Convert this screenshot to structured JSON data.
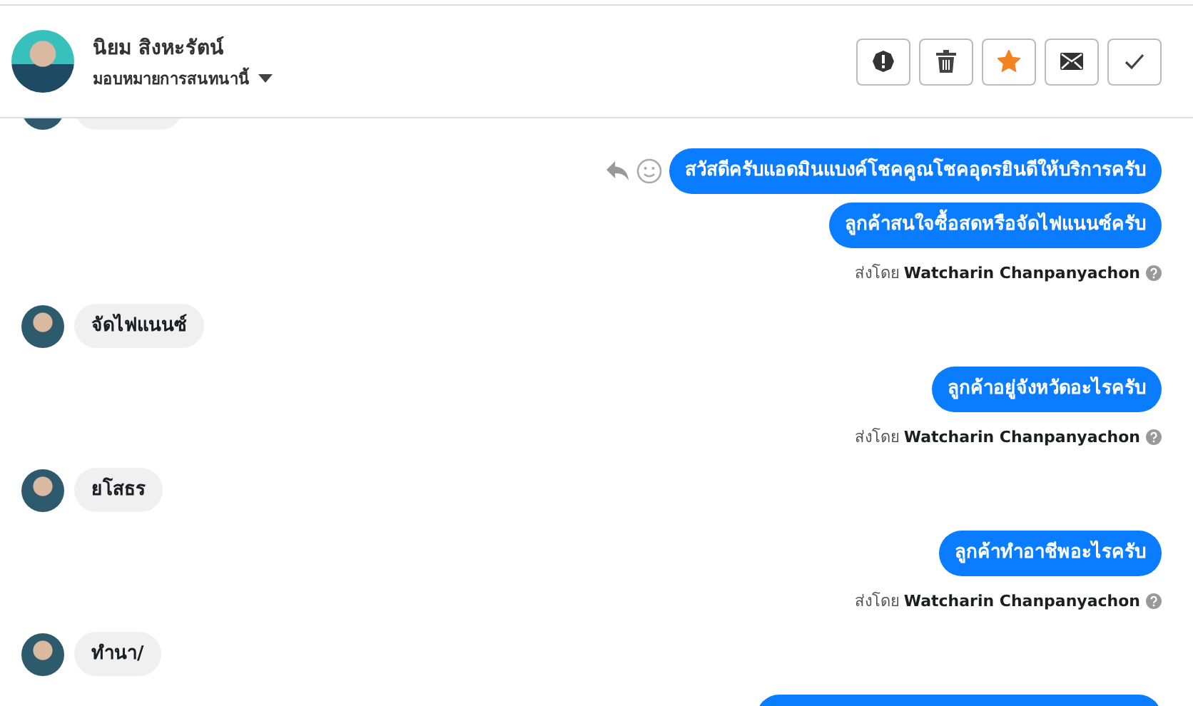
{
  "contact": {
    "name": "นิยม สิงหะรัตน์",
    "subtitle": "มอบหมายการสนทนานี้"
  },
  "actions": [
    {
      "kind": "report"
    },
    {
      "kind": "delete"
    },
    {
      "kind": "star",
      "on": true
    },
    {
      "kind": "mail"
    },
    {
      "kind": "done"
    }
  ],
  "messages": [
    {
      "kind": "incoming",
      "partial": true
    },
    {
      "kind": "outgoing",
      "bubbles": [
        {
          "text": "สวัสดีครับแอดมินแบงค์โชคคูณโชคอุดรยินดีให้บริการครับ",
          "hover_actions": true
        },
        {
          "text": "ลูกค้าสนใจซื้อสดหรือจัดไฟแนนซ์ครับ",
          "hover_actions": false
        }
      ],
      "sent_by_label": "ส่งโดย",
      "sender": "Watcharin Chanpanyachon"
    },
    {
      "kind": "incoming",
      "text": "จัดไฟแนนซ์"
    },
    {
      "kind": "outgoing",
      "bubbles": [
        {
          "text": "ลูกค้าอยู่จังหวัดอะไรครับ",
          "hover_actions": false
        }
      ],
      "sent_by_label": "ส่งโดย",
      "sender": "Watcharin Chanpanyachon"
    },
    {
      "kind": "incoming",
      "text": "ยโสธร"
    },
    {
      "kind": "outgoing",
      "bubbles": [
        {
          "text": "ลูกค้าทำอาชีพอะไรครับ",
          "hover_actions": false
        }
      ],
      "sent_by_label": "ส่งโดย",
      "sender": "Watcharin Chanpanyachon"
    },
    {
      "kind": "incoming",
      "text": "ทำนา/"
    },
    {
      "kind": "outgoing",
      "partial": true
    }
  ]
}
